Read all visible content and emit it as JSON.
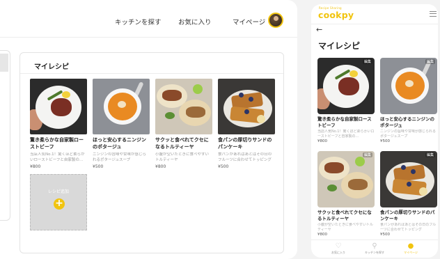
{
  "desktop": {
    "nav": {
      "search_kitchen": "キッチンを探す",
      "favorites": "お気に入り",
      "mypage": "マイページ"
    },
    "section_title": "マイレシピ",
    "recipes": [
      {
        "title": "驚き柔らかな自家製ローストビーフ",
        "description": "当店人気No.1！驚くほど柔らかいローストビーフと自家製の…",
        "price": "¥800",
        "image": "roast-beef"
      },
      {
        "title": "ほっと安心するニンジンのポタージュ",
        "description": "ニンジンの旨味や甘味が感じられるポタージュスープ",
        "price": "¥500",
        "image": "carrot-soup"
      },
      {
        "title": "サクッと食べれてクセになるトルティーヤ",
        "description": "小腹が空いたときに食べやすいトルティーヤ",
        "price": "¥800",
        "image": "tortilla"
      },
      {
        "title": "食パンの厚切りサンドのパンケーキ",
        "description": "食パンがあればあとはその日のフルーツに合わせてトッピング",
        "price": "¥500",
        "image": "french-toast"
      }
    ],
    "add_recipe_label": "レシピ追加"
  },
  "mobile": {
    "logo": "cookpy",
    "logo_tagline": "Recipe Sharing",
    "page_title": "マイレシピ",
    "badge": "編集",
    "recipes": [
      {
        "title": "驚き柔らかな自家製ローストビーフ",
        "description": "当店人気No.1！驚くほど柔らかいローストビーフと自家製の…",
        "price": "¥800"
      },
      {
        "title": "ほっと安心するニンジンのポタージュ",
        "description": "ニンジンの旨味や甘味が感じられるポタージュスープ",
        "price": "¥500"
      },
      {
        "title": "サクッと食べれてクセになるトルティーヤ",
        "description": "小腹が空いたときに食べやすいトルティーヤ",
        "price": "¥800"
      },
      {
        "title": "食パンの厚切りサンドのパンケーキ",
        "description": "食パンがあればあとはその日のフルーツに合わせてトッピング",
        "price": "¥500"
      }
    ],
    "tabs": [
      {
        "label": "お気に入り",
        "icon": "heart-icon",
        "active": false
      },
      {
        "label": "キッチンを探す",
        "icon": "search-icon",
        "active": false
      },
      {
        "label": "マイページ",
        "icon": "person-icon",
        "active": true
      }
    ]
  },
  "colors": {
    "accent": "#f1c40f",
    "background": "#f3f3f3"
  }
}
